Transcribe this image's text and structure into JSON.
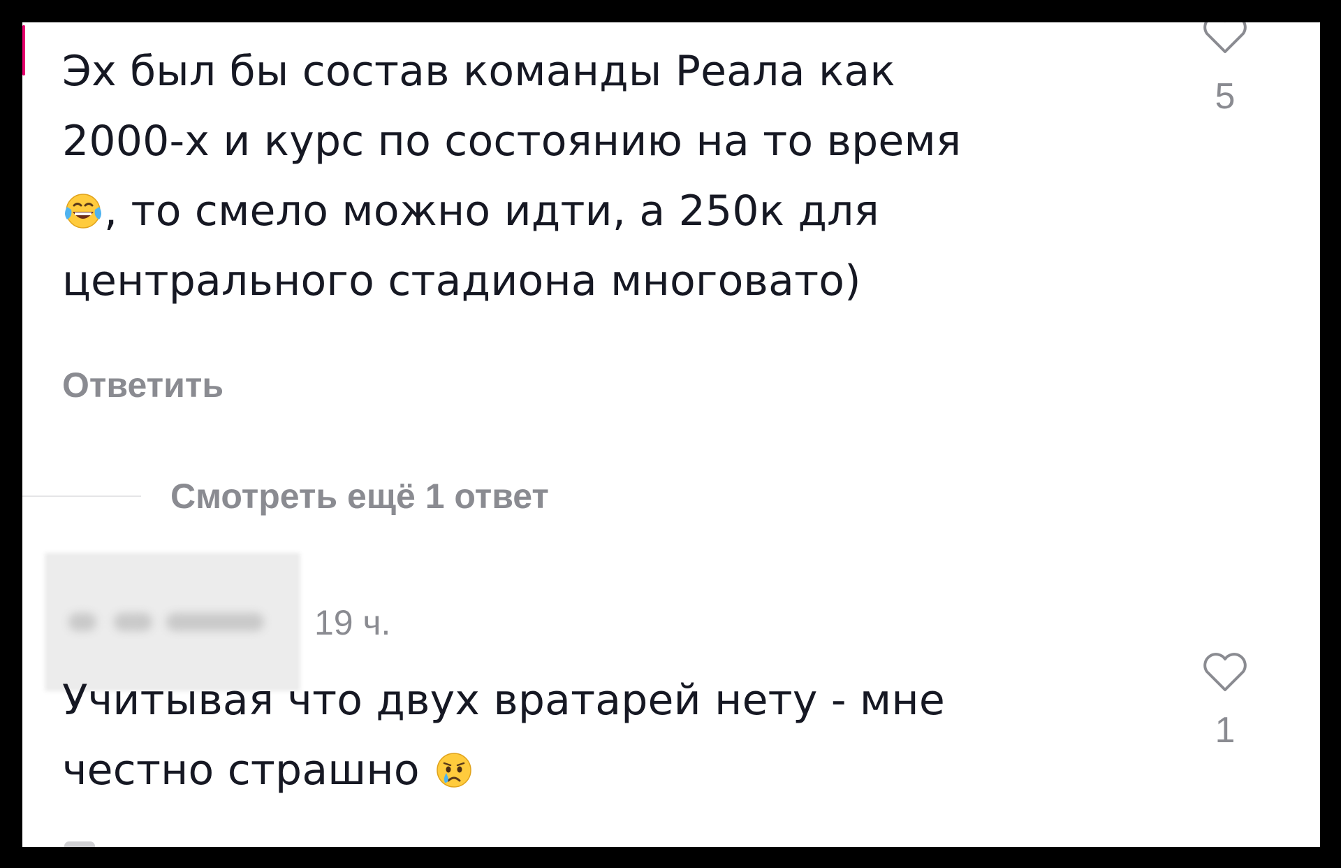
{
  "comments": [
    {
      "text_line1": "Эх был бы состав команды Реала как",
      "text_line2": "2000-х и курс по состоянию на то время",
      "text_line3_after_emoji": ", то смело можно идти, а 250к для",
      "text_line4": "центрального стадиона многовато)",
      "emoji": "face-with-tears-of-joy",
      "like_count": "5",
      "reply_label": "Ответить"
    },
    {
      "timestamp": "19 ч.",
      "text_line1": "Учитывая что двух вратарей нету - мне",
      "text_line2": "честно страшно",
      "emoji": "crying-face",
      "like_count": "1"
    }
  ],
  "view_replies_label": "Смотреть ещё 1 ответ",
  "colors": {
    "text": "#161823",
    "secondary": "#8a8b91",
    "background": "#ffffff",
    "frame": "#000000"
  }
}
